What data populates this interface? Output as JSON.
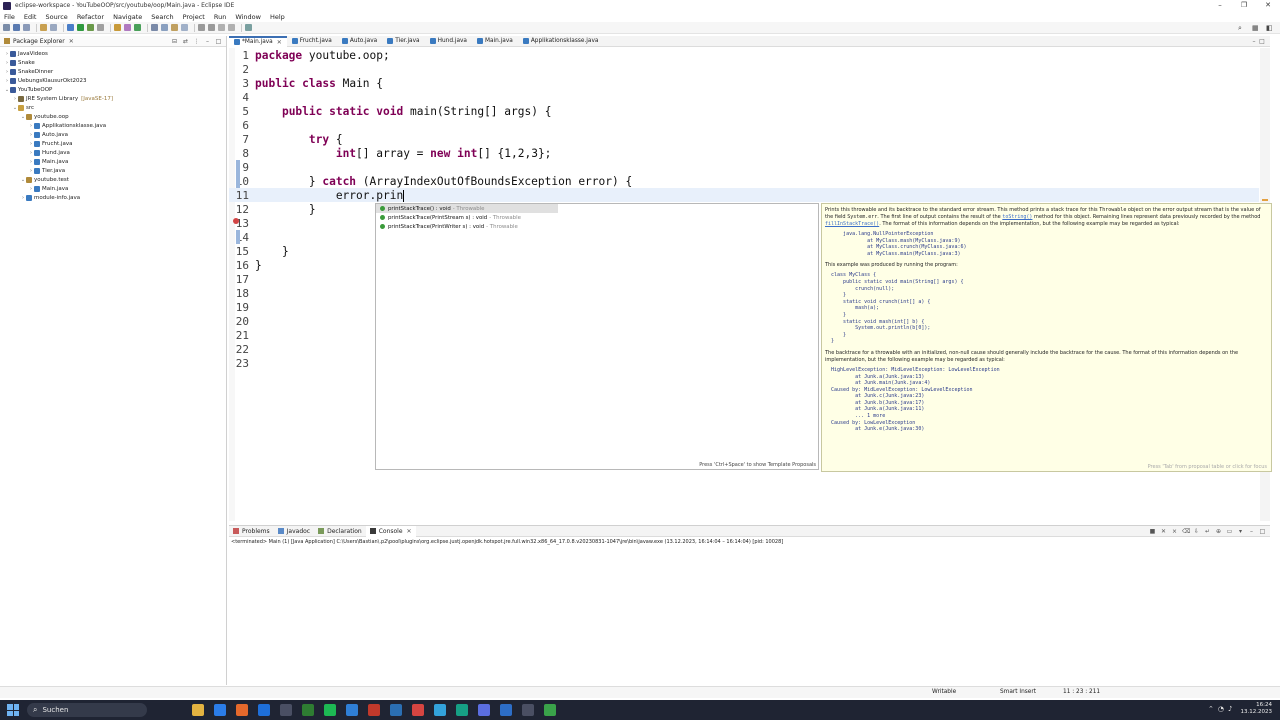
{
  "window": {
    "title": "eclipse-workspace - YouTubeOOP/src/youtube/oop/Main.java - Eclipse IDE"
  },
  "menu": [
    "File",
    "Edit",
    "Source",
    "Refactor",
    "Navigate",
    "Search",
    "Project",
    "Run",
    "Window",
    "Help"
  ],
  "explorer": {
    "tab_label": "Package Explorer",
    "tree": [
      {
        "label": "JavaVideos",
        "indent": 0,
        "expanded": false,
        "icon": "project-icon"
      },
      {
        "label": "Snake",
        "indent": 0,
        "expanded": false,
        "icon": "project-icon"
      },
      {
        "label": "SnakeDinner",
        "indent": 0,
        "expanded": false,
        "icon": "project-icon"
      },
      {
        "label": "UebungsKlausurOkt2023",
        "indent": 0,
        "expanded": false,
        "icon": "project-icon"
      },
      {
        "label": "YouTubeOOP",
        "indent": 0,
        "expanded": true,
        "icon": "project-icon"
      },
      {
        "label": "JRE System Library",
        "decoration": "[JavaSE-17]",
        "indent": 1,
        "expanded": false,
        "icon": "library-icon"
      },
      {
        "label": "src",
        "indent": 1,
        "expanded": true,
        "icon": "source-folder-icon"
      },
      {
        "label": "youtube.oop",
        "indent": 2,
        "expanded": true,
        "icon": "package-icon"
      },
      {
        "label": "Applikationsklasse.java",
        "indent": 3,
        "expanded": false,
        "icon": "java-file-icon"
      },
      {
        "label": "Auto.java",
        "indent": 3,
        "expanded": false,
        "icon": "java-file-icon"
      },
      {
        "label": "Frucht.java",
        "indent": 3,
        "expanded": false,
        "icon": "java-file-icon"
      },
      {
        "label": "Hund.java",
        "indent": 3,
        "expanded": false,
        "icon": "java-file-icon"
      },
      {
        "label": "Main.java",
        "indent": 3,
        "expanded": false,
        "icon": "java-file-icon"
      },
      {
        "label": "Tier.java",
        "indent": 3,
        "expanded": false,
        "icon": "java-file-icon"
      },
      {
        "label": "youtube.test",
        "indent": 2,
        "expanded": true,
        "icon": "package-icon"
      },
      {
        "label": "Main.java",
        "indent": 3,
        "expanded": false,
        "icon": "java-file-icon"
      },
      {
        "label": "module-info.java",
        "indent": 2,
        "expanded": false,
        "icon": "java-file-icon"
      }
    ]
  },
  "editor": {
    "tabs": [
      {
        "label": "*Main.java",
        "active": true
      },
      {
        "label": "Frucht.java",
        "active": false
      },
      {
        "label": "Auto.java",
        "active": false
      },
      {
        "label": "Tier.java",
        "active": false
      },
      {
        "label": "Hund.java",
        "active": false
      },
      {
        "label": "Main.java",
        "active": false
      },
      {
        "label": "Applikationsklasse.java",
        "active": false
      }
    ],
    "lines": [
      {
        "n": "1",
        "segments": [
          [
            "kw",
            "package"
          ],
          [
            "",
            " youtube.oop;"
          ]
        ]
      },
      {
        "n": "2",
        "segments": []
      },
      {
        "n": "3",
        "segments": [
          [
            "kw",
            "public"
          ],
          [
            "",
            " "
          ],
          [
            "kw",
            "class"
          ],
          [
            "",
            " Main {"
          ]
        ]
      },
      {
        "n": "4",
        "segments": []
      },
      {
        "n": "5",
        "segments": [
          [
            "",
            "    "
          ],
          [
            "kw",
            "public"
          ],
          [
            "",
            " "
          ],
          [
            "kw",
            "static"
          ],
          [
            "",
            " "
          ],
          [
            "kw",
            "void"
          ],
          [
            "",
            " main(String[] args) {"
          ]
        ]
      },
      {
        "n": "6",
        "segments": []
      },
      {
        "n": "7",
        "segments": [
          [
            "",
            "        "
          ],
          [
            "kw",
            "try"
          ],
          [
            "",
            " {"
          ]
        ]
      },
      {
        "n": "8",
        "segments": [
          [
            "",
            "            "
          ],
          [
            "kw",
            "int"
          ],
          [
            "",
            "[] array = "
          ],
          [
            "kw",
            "new"
          ],
          [
            "",
            " "
          ],
          [
            "kw",
            "int"
          ],
          [
            "",
            "[] {1,2,3};"
          ]
        ]
      },
      {
        "n": "9",
        "segments": []
      },
      {
        "n": "10",
        "segments": [
          [
            "",
            "        } "
          ],
          [
            "kw",
            "catch"
          ],
          [
            "",
            " (ArrayIndexOutOfBoundsException error) {"
          ]
        ]
      },
      {
        "n": "11",
        "segments": [
          [
            "",
            "            error.prin"
          ]
        ],
        "current": true
      },
      {
        "n": "12",
        "segments": [
          [
            "",
            "        }"
          ]
        ]
      },
      {
        "n": "13",
        "segments": []
      },
      {
        "n": "14",
        "segments": []
      },
      {
        "n": "15",
        "segments": [
          [
            "",
            "    }"
          ]
        ]
      },
      {
        "n": "16",
        "segments": [
          [
            "",
            "}"
          ]
        ]
      },
      {
        "n": "17",
        "segments": []
      },
      {
        "n": "18",
        "segments": []
      },
      {
        "n": "19",
        "segments": []
      },
      {
        "n": "20",
        "segments": []
      },
      {
        "n": "21",
        "segments": []
      },
      {
        "n": "22",
        "segments": []
      },
      {
        "n": "23",
        "segments": []
      }
    ]
  },
  "assist": {
    "proposals": [
      {
        "name": "printStackTrace() : void",
        "owner": "- Throwable",
        "selected": true
      },
      {
        "name": "printStackTrace(PrintStream s) : void",
        "owner": "- Throwable",
        "selected": false
      },
      {
        "name": "printStackTrace(PrintWriter s) : void",
        "owner": "- Throwable",
        "selected": false
      }
    ],
    "footer": "Press 'Ctrl+Space' to show Template Proposals"
  },
  "javadoc": {
    "p1a": "Prints this throwable and its backtrace to the standard error stream. This method prints a stack trace for this ",
    "p1b": "Throwable",
    "p1c": " object on the error output stream that is the value of the field ",
    "p1d": "System.err",
    "p1e": ". The first line of output contains the result of the ",
    "p1f": "toString()",
    "p1g": " method for this object. Remaining lines represent data previously recorded by the method ",
    "p1h": "fillInStackTrace()",
    "p1i": ". The format of this information depends on the implementation, but the following example may be regarded as typical:",
    "code1": "      java.lang.NullPointerException\n              at MyClass.mash(MyClass.java:9)\n              at MyClass.crunch(MyClass.java:6)\n              at MyClass.main(MyClass.java:3)",
    "p2": "This example was produced by running the program:",
    "code2": "  class MyClass {\n      public static void main(String[] args) {\n          crunch(null);\n      }\n      static void crunch(int[] a) {\n          mash(a);\n      }\n      static void mash(int[] b) {\n          System.out.println(b[0]);\n      }\n  }",
    "p3": "The backtrace for a throwable with an initialized, non-null cause should generally include the backtrace for the cause. The format of this information depends on the implementation, but the following example may be regarded as typical:",
    "code3": "  HighLevelException: MidLevelException: LowLevelException\n          at Junk.a(Junk.java:13)\n          at Junk.main(Junk.java:4)\n  Caused by: MidLevelException: LowLevelException\n          at Junk.c(Junk.java:23)\n          at Junk.b(Junk.java:17)\n          at Junk.a(Junk.java:11)\n          ... 1 more\n  Caused by: LowLevelException\n          at Junk.e(Junk.java:30)",
    "hint": "Press 'Tab' from proposal table or click for focus"
  },
  "console": {
    "tabs": [
      "Problems",
      "Javadoc",
      "Declaration",
      "Console"
    ],
    "active_tab": "Console",
    "status": "<terminated> Main (1) [Java Application] C:\\Users\\Bastian\\.p2\\pool\\plugins\\org.eclipse.justj.openjdk.hotspot.jre.full.win32.x86_64_17.0.8.v20230831-1047\\jre\\bin\\javaw.exe  (13.12.2023, 16:14:04 – 16:14:04) [pid: 10028]"
  },
  "statusbar": {
    "writable": "Writable",
    "insert_mode": "Smart Insert",
    "position": "11 : 23 : 211"
  },
  "taskbar": {
    "search_placeholder": "Suchen",
    "time": "16:24",
    "date": "13.12.2023",
    "app_colors": [
      "#e3b341",
      "#2b7de9",
      "#e5692c",
      "#1e6fd9",
      "#4a4f63",
      "#2e7d32",
      "#1db954",
      "#2f7fd6",
      "#c0392b",
      "#2b6fb3",
      "#d64541",
      "#33a3dc",
      "#16a085",
      "#5b6ee1",
      "#2d6ec8",
      "#4a4f63",
      "#3aa34a"
    ]
  },
  "colors": {
    "keyword": "#7f0055",
    "current_line": "#e8f0fb",
    "javadoc_bg": "#ffffe6"
  }
}
